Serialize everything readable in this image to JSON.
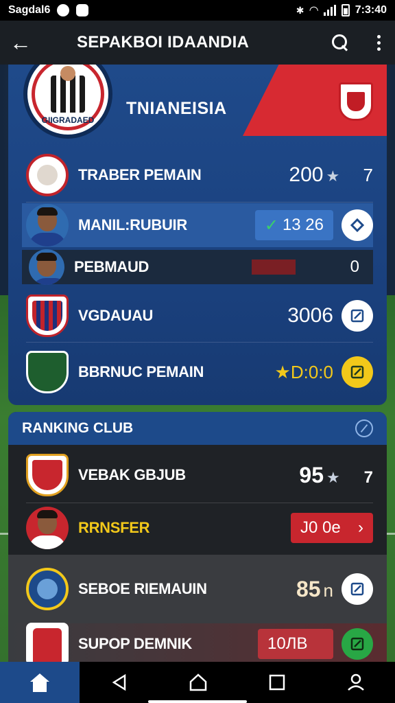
{
  "status_bar": {
    "carrier": "Sagdal6",
    "time": "7:3:40"
  },
  "app_bar": {
    "title": "SEPAKBOI IDAANDIA"
  },
  "club": {
    "name": "TNIANEISIA",
    "crest_text": "GIIGRADAED"
  },
  "player_rows": [
    {
      "label": "TRABER PEMAIN",
      "value": "200",
      "extra": "7"
    },
    {
      "label": "MANIL:RUBUIR",
      "value": "13 26"
    },
    {
      "label": "PEBMAUD",
      "value": "0"
    },
    {
      "label": "VGDAUAU",
      "value": "3006"
    },
    {
      "label": "BBRNUC PEMAIN",
      "value": "D:0:0"
    }
  ],
  "ranking": {
    "title": "RANKING CLUB",
    "rows": [
      {
        "label": "VEBAK GBJUB",
        "value": "95",
        "extra": "7"
      },
      {
        "label": "RRNSFER",
        "value": "J0 0e"
      },
      {
        "label": "SEBOE RIEMAUIN",
        "value": "85",
        "extra": "n"
      },
      {
        "label": "SUPOP DEMNIK",
        "value": "10ЛB"
      }
    ]
  },
  "colors": {
    "accent_blue": "#1d4a8a",
    "accent_red": "#c8262e",
    "gold": "#f2c81a"
  }
}
